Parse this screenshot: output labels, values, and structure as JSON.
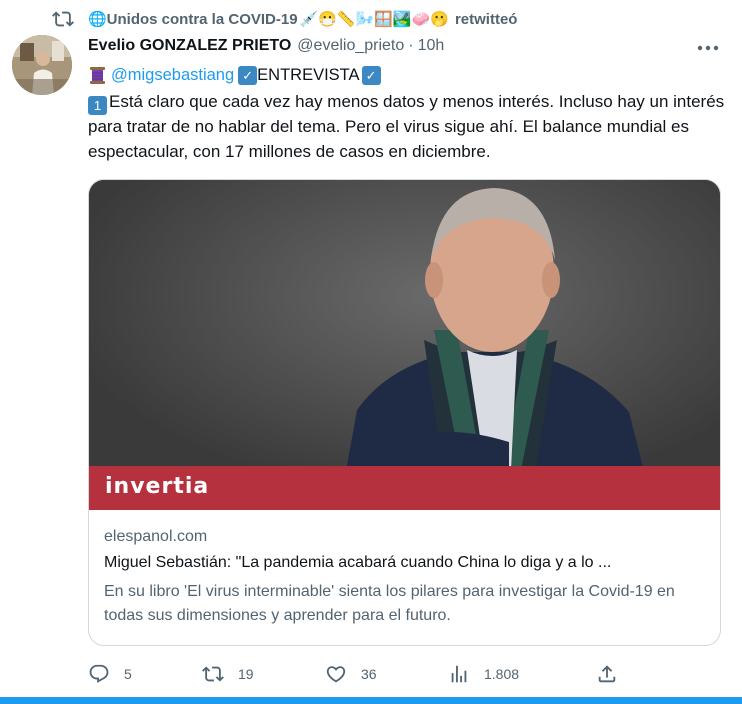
{
  "retweet": {
    "icon": "retweet-icon",
    "account": "🌐Unidos contra la COVID-19",
    "emojis": "💉😷📏🌬️🪟🏞️🧼🫢",
    "action": "retwitteó"
  },
  "author": {
    "name": "Evelio GONZALEZ PRIETO",
    "handle": "@evelio_prieto",
    "separator": "·",
    "time": "10h"
  },
  "tweet": {
    "mention": "@migsebastiang",
    "tag": "ENTREVISTA",
    "check_glyph": "✓",
    "number_glyph": "1",
    "body": "Está claro que cada vez hay menos datos y menos interés. Incluso hay un interés para tratar de no hablar del tema. Pero el virus sigue ahí. El balance mundial es espectacular, con 17 millones de casos en diciembre."
  },
  "card": {
    "brand": "invertia",
    "domain": "elespanol.com",
    "title": "Miguel Sebastián: \"La pandemia acabará cuando China lo diga y a lo ...",
    "description": "En su libro 'El virus interminable' sienta los pilares para investigar la Covid-19 en todas sus dimensiones y aprender para el futuro.",
    "brand_color": "#b5313e"
  },
  "actions": {
    "replies": "5",
    "retweets": "19",
    "likes": "36",
    "views": "1.808"
  },
  "colors": {
    "accent": "#1d9bf0",
    "muted": "#536471",
    "text": "#0f1419"
  }
}
